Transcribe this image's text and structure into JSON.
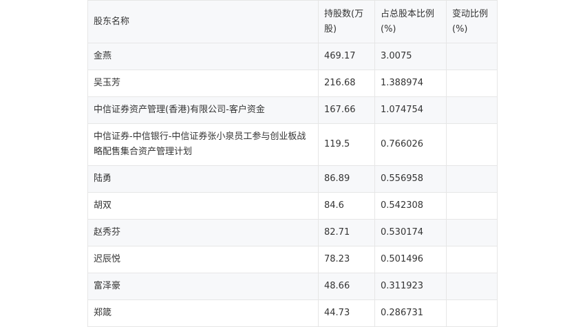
{
  "table": {
    "headers": [
      "股东名称",
      "持股数(万股)",
      "占总股本比例(%)",
      "变动比例(%)"
    ],
    "rows": [
      {
        "name": "金燕",
        "shares": "469.17",
        "ratio": "3.0075",
        "change": ""
      },
      {
        "name": "吴玉芳",
        "shares": "216.68",
        "ratio": "1.388974",
        "change": ""
      },
      {
        "name": "中信证券资产管理(香港)有限公司-客户资金",
        "shares": "167.66",
        "ratio": "1.074754",
        "change": ""
      },
      {
        "name": "中信证券-中信银行-中信证券张小泉员工参与创业板战略配售集合资产管理计划",
        "shares": "119.5",
        "ratio": "0.766026",
        "change": ""
      },
      {
        "name": "陆勇",
        "shares": "86.89",
        "ratio": "0.556958",
        "change": ""
      },
      {
        "name": "胡双",
        "shares": "84.6",
        "ratio": "0.542308",
        "change": ""
      },
      {
        "name": "赵秀芬",
        "shares": "82.71",
        "ratio": "0.530174",
        "change": ""
      },
      {
        "name": "迟辰悦",
        "shares": "78.23",
        "ratio": "0.501496",
        "change": ""
      },
      {
        "name": "富泽豪",
        "shares": "48.66",
        "ratio": "0.311923",
        "change": ""
      },
      {
        "name": "郑箴",
        "shares": "44.73",
        "ratio": "0.286731",
        "change": ""
      }
    ]
  }
}
